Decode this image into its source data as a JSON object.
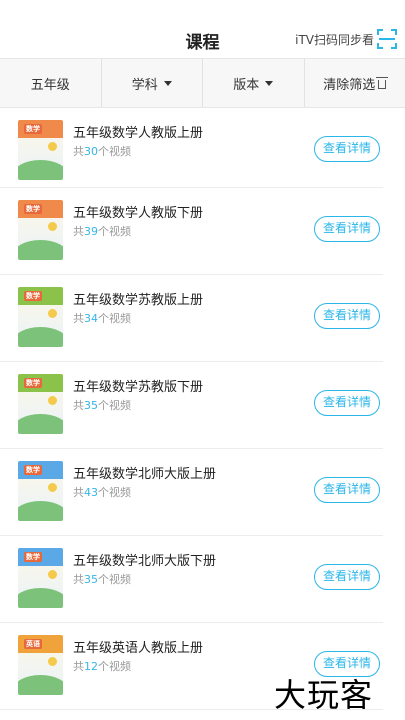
{
  "header": {
    "title": "课程",
    "itv_label": "iTV扫码同步看"
  },
  "filters": [
    {
      "label": "五年级",
      "dropdown": false
    },
    {
      "label": "学科",
      "dropdown": true
    },
    {
      "label": "版本",
      "dropdown": true
    },
    {
      "label": "清除筛选",
      "dropdown": false
    }
  ],
  "courses": [
    {
      "name": "五年级数学人教版上册",
      "count_prefix": "共",
      "count": "30",
      "count_suffix": "个视频",
      "button": "查看详情",
      "cover_label": "数学",
      "cover_color": "#f08a4b"
    },
    {
      "name": "五年级数学人教版下册",
      "count_prefix": "共",
      "count": "39",
      "count_suffix": "个视频",
      "button": "查看详情",
      "cover_label": "数学",
      "cover_color": "#f08a4b"
    },
    {
      "name": "五年级数学苏教版上册",
      "count_prefix": "共",
      "count": "34",
      "count_suffix": "个视频",
      "button": "查看详情",
      "cover_label": "数学",
      "cover_color": "#8bc34a"
    },
    {
      "name": "五年级数学苏教版下册",
      "count_prefix": "共",
      "count": "35",
      "count_suffix": "个视频",
      "button": "查看详情",
      "cover_label": "数学",
      "cover_color": "#8bc34a"
    },
    {
      "name": "五年级数学北师大版上册",
      "count_prefix": "共",
      "count": "43",
      "count_suffix": "个视频",
      "button": "查看详情",
      "cover_label": "数学",
      "cover_color": "#5aa9e6"
    },
    {
      "name": "五年级数学北师大版下册",
      "count_prefix": "共",
      "count": "35",
      "count_suffix": "个视频",
      "button": "查看详情",
      "cover_label": "数学",
      "cover_color": "#5aa9e6"
    },
    {
      "name": "五年级英语人教版上册",
      "count_prefix": "共",
      "count": "12",
      "count_suffix": "个视频",
      "button": "查看详情",
      "cover_label": "英语",
      "cover_color": "#f0a23b"
    }
  ],
  "watermark": "大玩客",
  "colors": {
    "accent": "#2bb6e8",
    "count_number": "#34b6e6"
  }
}
